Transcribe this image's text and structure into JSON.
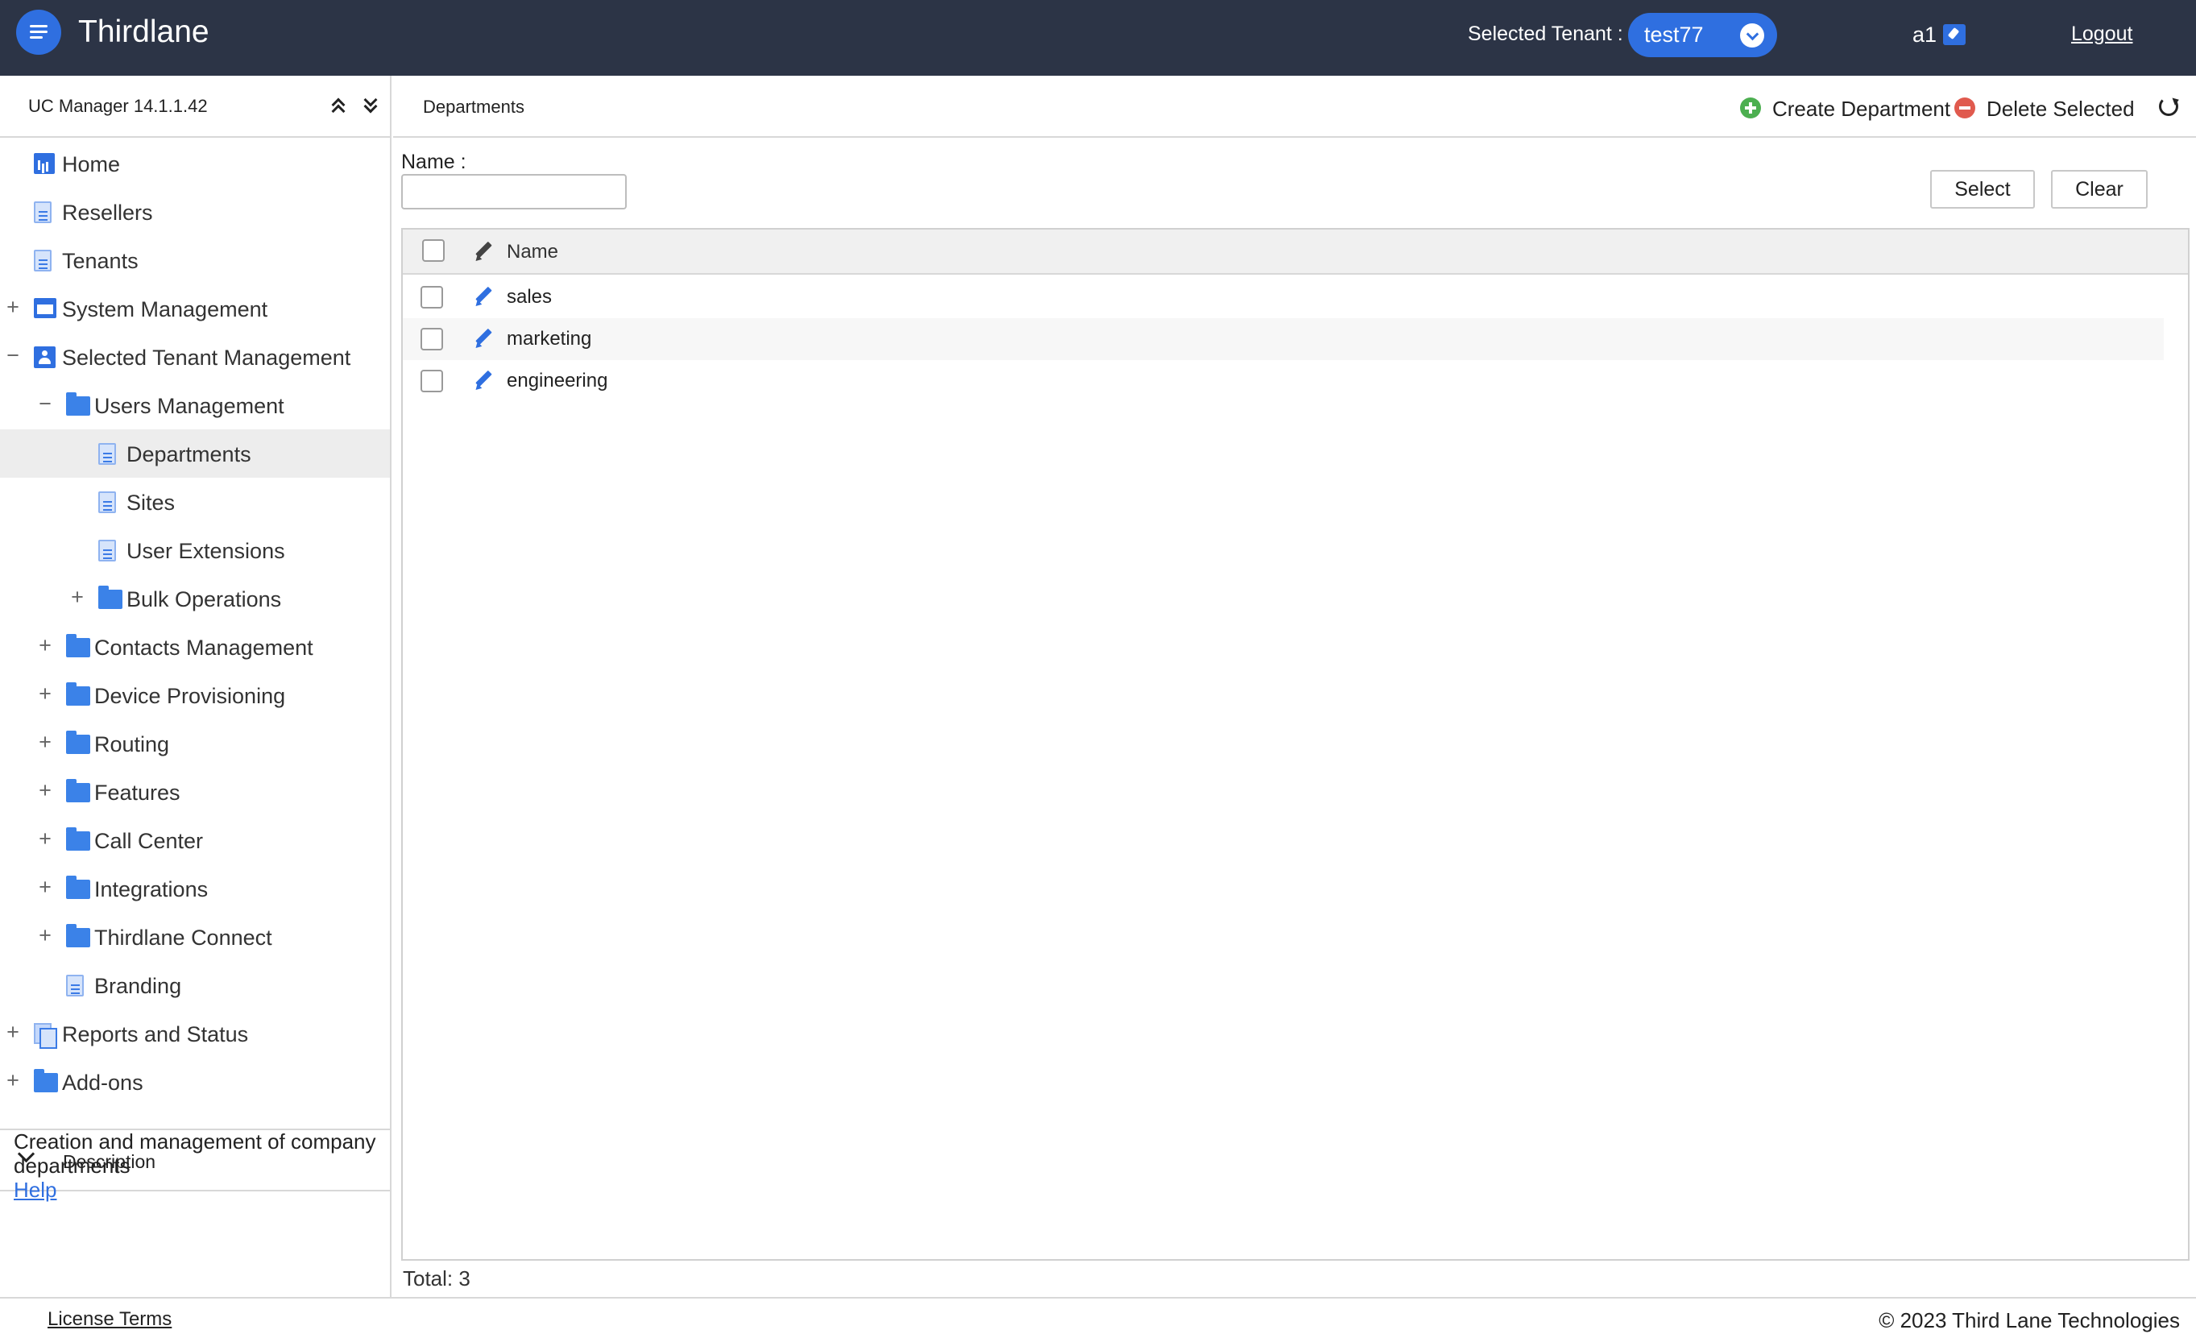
{
  "header": {
    "brand": "Thirdlane",
    "tenant_label": "Selected Tenant :",
    "tenant_value": "test77",
    "user": "a1",
    "logout": "Logout"
  },
  "sidebar": {
    "version": "UC Manager 14.1.1.42",
    "items": [
      {
        "label": "Home",
        "icon": "chart-icon",
        "toggle": "",
        "active": false
      },
      {
        "label": "Resellers",
        "icon": "document-icon",
        "toggle": "",
        "active": false
      },
      {
        "label": "Tenants",
        "icon": "document-icon",
        "toggle": "",
        "active": false
      },
      {
        "label": "System Management",
        "icon": "window-icon",
        "toggle": "+",
        "active": false
      },
      {
        "label": "Selected Tenant Management",
        "icon": "person-card-icon",
        "toggle": "−",
        "active": false
      },
      {
        "label": "Users Management",
        "icon": "folder-icon",
        "toggle": "−",
        "active": false
      },
      {
        "label": "Departments",
        "icon": "document-icon",
        "toggle": "",
        "active": true
      },
      {
        "label": "Sites",
        "icon": "document-icon",
        "toggle": "",
        "active": false
      },
      {
        "label": "User Extensions",
        "icon": "document-icon",
        "toggle": "",
        "active": false
      },
      {
        "label": "Bulk Operations",
        "icon": "folder-icon",
        "toggle": "+",
        "active": false
      },
      {
        "label": "Contacts Management",
        "icon": "folder-icon",
        "toggle": "+",
        "active": false
      },
      {
        "label": "Device Provisioning",
        "icon": "folder-icon",
        "toggle": "+",
        "active": false
      },
      {
        "label": "Routing",
        "icon": "folder-icon",
        "toggle": "+",
        "active": false
      },
      {
        "label": "Features",
        "icon": "folder-icon",
        "toggle": "+",
        "active": false
      },
      {
        "label": "Call Center",
        "icon": "folder-icon",
        "toggle": "+",
        "active": false
      },
      {
        "label": "Integrations",
        "icon": "folder-icon",
        "toggle": "+",
        "active": false
      },
      {
        "label": "Thirdlane Connect",
        "icon": "folder-icon",
        "toggle": "+",
        "active": false
      },
      {
        "label": "Branding",
        "icon": "document-icon",
        "toggle": "",
        "active": false
      },
      {
        "label": "Reports and Status",
        "icon": "documents-icon",
        "toggle": "+",
        "active": false
      },
      {
        "label": "Add-ons",
        "icon": "folder-icon",
        "toggle": "+",
        "active": false
      }
    ],
    "description_title": "Description",
    "description_text": "Creation and management of company departments",
    "help": "Help"
  },
  "main": {
    "title": "Departments",
    "create_label": "Create Department",
    "delete_label": "Delete Selected",
    "filter_label": "Name :",
    "filter_value": "",
    "select_label": "Select",
    "clear_label": "Clear",
    "column_name": "Name",
    "rows": [
      "sales",
      "marketing",
      "engineering"
    ],
    "total": "Total: 3"
  },
  "footer": {
    "license": "License Terms",
    "copyright": "© 2023 Third Lane Technologies"
  },
  "colors": {
    "header_bg": "#2c3446",
    "accent": "#2f6fe0",
    "create_green": "#4caf50",
    "delete_red": "#e05a4e",
    "active_row": "#ededed"
  }
}
